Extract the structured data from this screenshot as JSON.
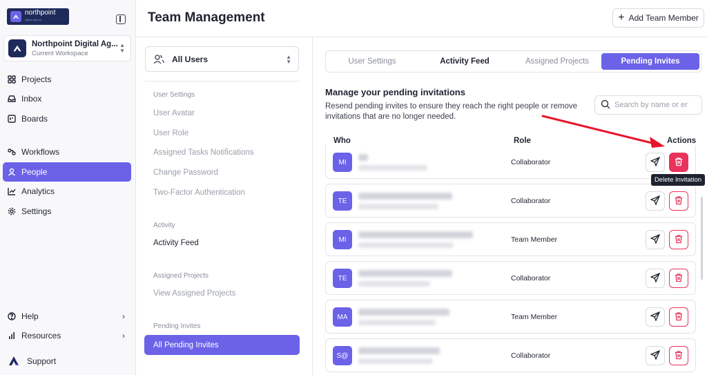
{
  "app": {
    "logo_text": "northpoint",
    "logo_sub": "digital agency",
    "workspace_name": "Northpoint Digital Ag...",
    "workspace_sub": "Current Workspace"
  },
  "sidebar": {
    "items": [
      {
        "label": "Projects",
        "icon": "grid-icon"
      },
      {
        "label": "Inbox",
        "icon": "inbox-icon"
      },
      {
        "label": "Boards",
        "icon": "board-icon"
      },
      {
        "label": "Workflows",
        "icon": "workflow-icon"
      },
      {
        "label": "People",
        "icon": "person-icon",
        "active": true
      },
      {
        "label": "Analytics",
        "icon": "analytics-icon"
      },
      {
        "label": "Settings",
        "icon": "gear-icon"
      }
    ],
    "bottom": [
      {
        "label": "Help",
        "icon": "help-icon"
      },
      {
        "label": "Resources",
        "icon": "bar-chart-icon"
      },
      {
        "label": "Support",
        "icon": "support-logo-icon"
      }
    ]
  },
  "header": {
    "title": "Team Management",
    "add_button": "Add Team Member"
  },
  "settings": {
    "selector": "All Users",
    "sections": [
      {
        "heading": "User Settings",
        "items": [
          "User Avatar",
          "User Role",
          "Assigned Tasks Notifications",
          "Change Password",
          "Two-Factor Authentication"
        ]
      },
      {
        "heading": "Activity",
        "items": [
          "Activity Feed"
        ]
      },
      {
        "heading": "Assigned Projects",
        "items": [
          "View Assigned Projects"
        ]
      },
      {
        "heading": "Pending Invites",
        "items": [
          "All Pending Invites"
        ]
      }
    ]
  },
  "tabs": [
    "User Settings",
    "Activity Feed",
    "Assigned Projects",
    "Pending Invites"
  ],
  "main": {
    "title": "Manage your pending invitations",
    "description": "Resend pending invites to ensure they reach the right people or remove invitations that are no longer needed.",
    "search_placeholder": "Search by name or er",
    "columns": {
      "who": "Who",
      "role": "Role",
      "actions": "Actions"
    },
    "tooltip": "Delete Invitation"
  },
  "invites": [
    {
      "initials": "MI",
      "role": "Collaborator"
    },
    {
      "initials": "TE",
      "role": "Collaborator"
    },
    {
      "initials": "MI",
      "role": "Team Member"
    },
    {
      "initials": "TE",
      "role": "Collaborator"
    },
    {
      "initials": "MA",
      "role": "Team Member"
    },
    {
      "initials": "S@",
      "role": "Collaborator"
    }
  ],
  "colors": {
    "accent": "#6b62e8",
    "danger": "#e8335a",
    "annotation_arrow": "#e8162a"
  }
}
